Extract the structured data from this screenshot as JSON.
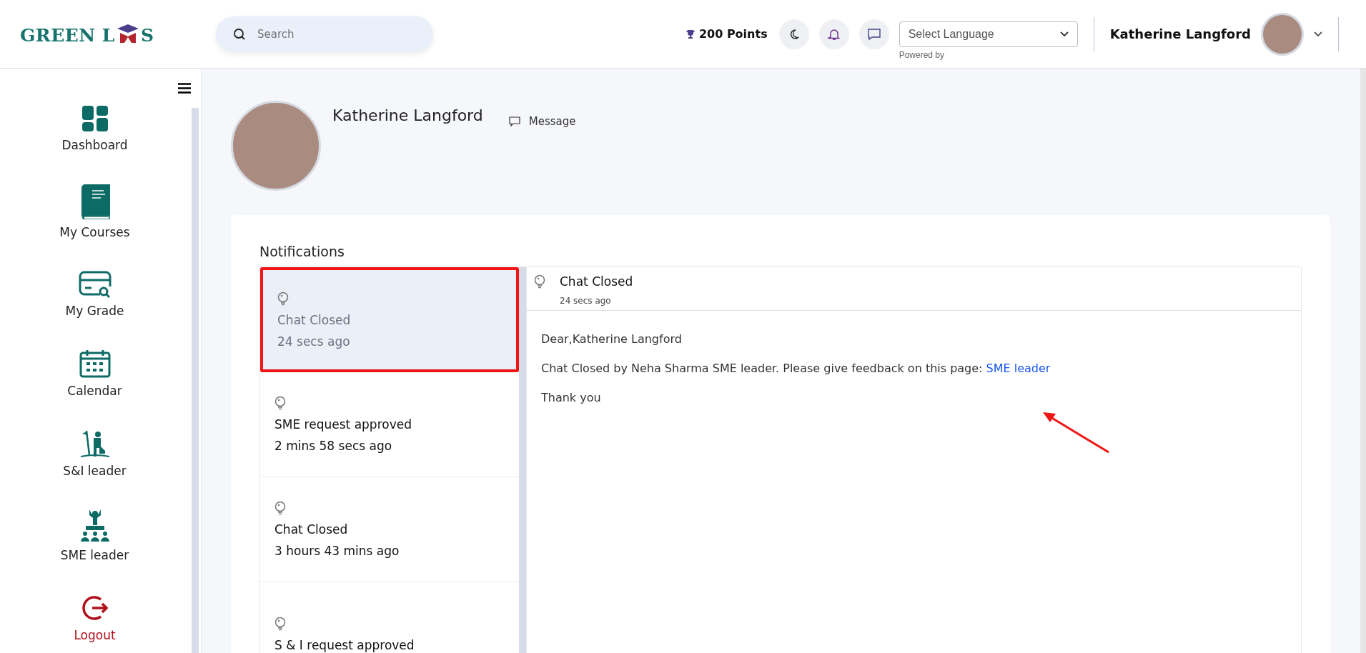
{
  "header": {
    "logo": {
      "text_left": "GREEN L",
      "text_right": "S"
    },
    "search": {
      "placeholder": "Search"
    },
    "points": "200 Points",
    "language": {
      "placeholder": "Select Language",
      "powered_by": "Powered by"
    },
    "user_name": "Katherine Langford"
  },
  "sidebar": {
    "items": [
      {
        "label": "Dashboard",
        "kind": "dashboard"
      },
      {
        "label": "My Courses",
        "kind": "courses"
      },
      {
        "label": "My Grade",
        "kind": "grade"
      },
      {
        "label": "Calendar",
        "kind": "calendar"
      },
      {
        "label": "S&I leader",
        "kind": "sileader"
      },
      {
        "label": "SME leader",
        "kind": "smeleader"
      },
      {
        "label": "Logout",
        "kind": "logout"
      }
    ]
  },
  "profile": {
    "name": "Katherine Langford",
    "message": "Message"
  },
  "notifications": {
    "title": "Notifications",
    "items": [
      {
        "title": "Chat Closed",
        "time": "24 secs ago",
        "selected": true
      },
      {
        "title": "SME request approved",
        "time": "2 mins 58 secs ago",
        "selected": false
      },
      {
        "title": "Chat Closed",
        "time": "3 hours 43 mins ago",
        "selected": false
      },
      {
        "title": "S & I request approved",
        "selected": false
      }
    ],
    "detail": {
      "title": "Chat Closed",
      "time": "24 secs ago",
      "greeting": "Dear,Katherine Langford",
      "body": "Chat Closed by Neha Sharma SME leader. Please give feedback on this page:",
      "link": "SME leader",
      "closing": "Thank you"
    }
  }
}
